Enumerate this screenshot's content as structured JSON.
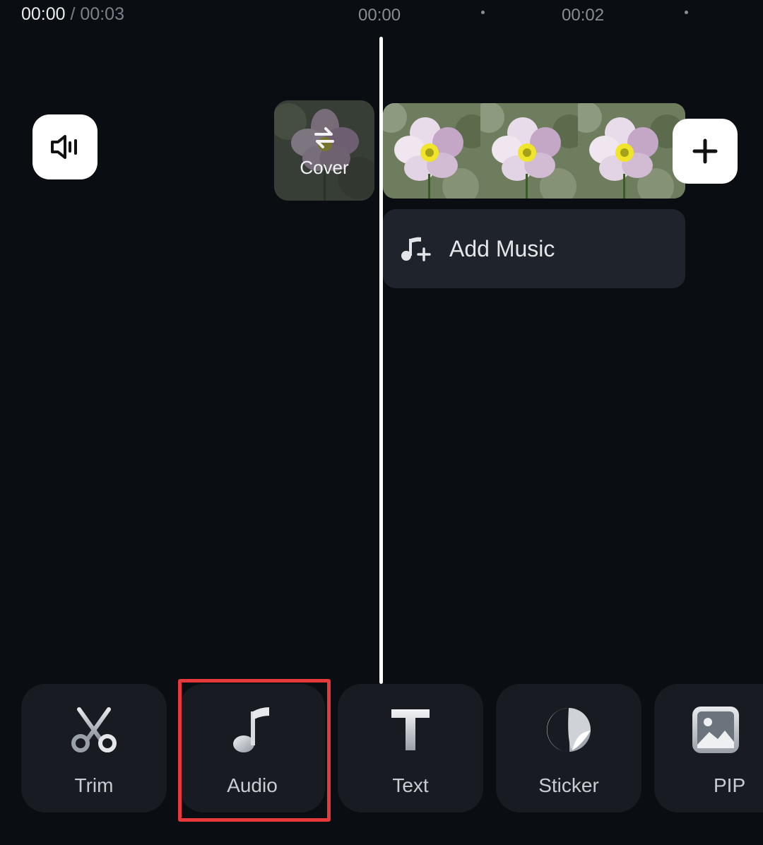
{
  "timeline": {
    "current_time": "00:00",
    "separator": "/",
    "total_time": "00:03",
    "ruler_marks": [
      "00:00",
      "00:02"
    ]
  },
  "cover": {
    "label": "Cover"
  },
  "music": {
    "add_label": "Add Music"
  },
  "toolbar": {
    "tools": [
      {
        "label": "Trim",
        "icon": "scissors-icon"
      },
      {
        "label": "Audio",
        "icon": "music-note-icon"
      },
      {
        "label": "Text",
        "icon": "text-icon"
      },
      {
        "label": "Sticker",
        "icon": "sticker-icon"
      },
      {
        "label": "PIP",
        "icon": "image-icon"
      }
    ],
    "highlighted": "Audio"
  },
  "colors": {
    "background": "#0a0d12",
    "tile": "#181b21",
    "highlight": "#e5393b",
    "playhead": "#ffffff"
  }
}
